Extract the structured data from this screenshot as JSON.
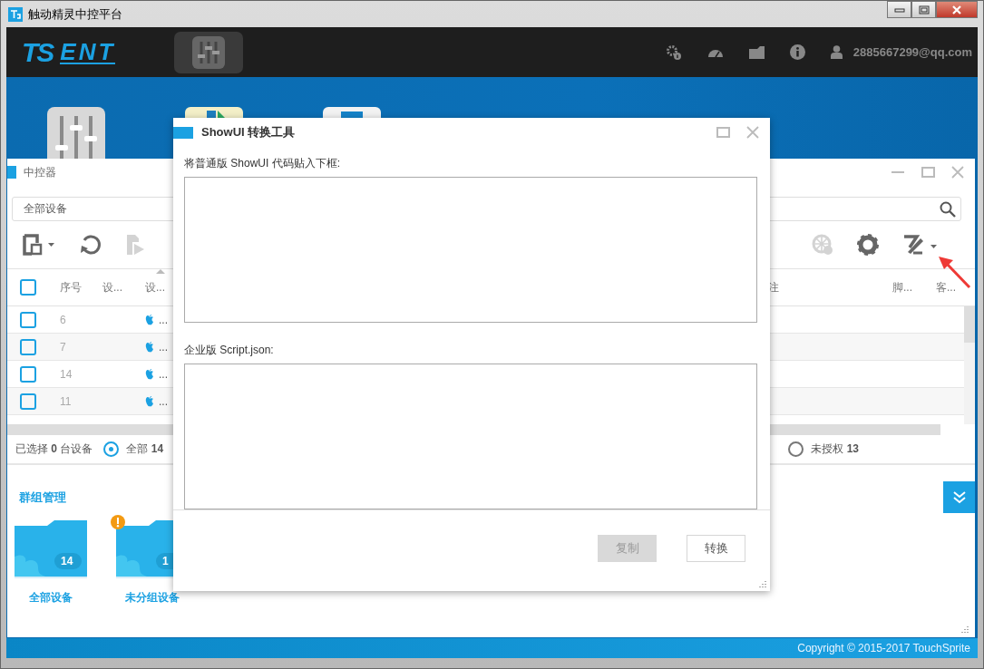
{
  "window": {
    "title": "触动精灵中控平台"
  },
  "header": {
    "logo_mark": "TS",
    "logo_word": "ENT",
    "account": "2885667299@qq.com"
  },
  "controller": {
    "title": "中控器",
    "search": {
      "value": "全部设备"
    },
    "toolbar_left": [
      {
        "disabled": false
      },
      {
        "disabled": false
      },
      {
        "disabled": true
      }
    ],
    "toolbar_right": [
      {
        "disabled": true
      },
      {
        "disabled": false
      },
      {
        "disabled": false
      }
    ],
    "select_all": {
      "checked": false
    },
    "columns": [
      {
        "label": "序号",
        "sorted": false
      },
      {
        "label": "设...",
        "sorted": false
      },
      {
        "label": "设...",
        "sorted": true
      },
      {
        "label": "注",
        "sorted": false
      },
      {
        "label": "脚...",
        "sorted": false
      },
      {
        "label": "客...",
        "sorted": false
      }
    ],
    "rows": [
      {
        "checked": false,
        "index": "6",
        "device": "..."
      },
      {
        "checked": false,
        "index": "7",
        "device": "..."
      },
      {
        "checked": false,
        "index": "14",
        "device": "..."
      },
      {
        "checked": false,
        "index": "11",
        "device": "..."
      }
    ],
    "status": {
      "selected_text": "已选择 **0** 台设备",
      "filters": [
        {
          "label": "全部",
          "count": "14",
          "selected": true
        },
        {
          "label": "未授权",
          "count": "13",
          "selected": false
        }
      ]
    },
    "groups": {
      "title": "群组管理",
      "folders": [
        {
          "name": "全部设备",
          "count": "14",
          "warning": false
        },
        {
          "name": "未分组设备",
          "count": "1",
          "warning": true
        }
      ]
    }
  },
  "dialog": {
    "title": "ShowUI 转换工具",
    "source_label": "将普通版 ShowUI 代码贴入下框:",
    "target_label": "企业版 Script.json:",
    "buttons": [
      {
        "label": "复制",
        "disabled": true
      },
      {
        "label": "转换",
        "disabled": false
      }
    ]
  },
  "footer": {
    "copyright": "Copyright © 2015-2017 TouchSprite"
  }
}
